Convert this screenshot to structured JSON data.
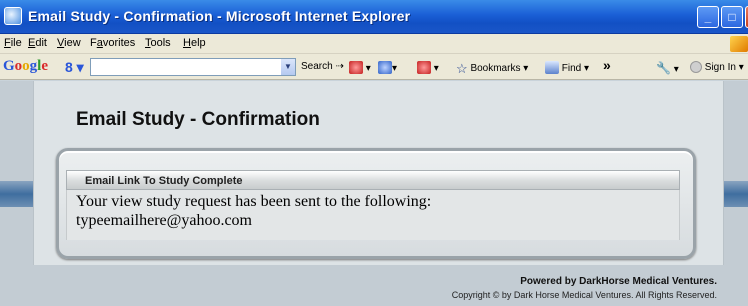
{
  "window": {
    "title": "Email Study - Confirmation - Microsoft Internet Explorer",
    "minimize": "_",
    "maximize": "□",
    "close": "×"
  },
  "menu": {
    "items": [
      {
        "key": "F",
        "rest": "ile"
      },
      {
        "key": "E",
        "rest": "dit"
      },
      {
        "key": "V",
        "rest": "iew"
      },
      {
        "key": "a",
        "pre": "F",
        "rest": "vorites"
      },
      {
        "key": "T",
        "rest": "ools"
      },
      {
        "key": "H",
        "rest": "elp"
      }
    ]
  },
  "toolbar": {
    "google_logo": "Google",
    "search_box_prefix": "8",
    "search_label": "Search",
    "bookmarks_label": "Bookmarks",
    "find_label": "Find",
    "more_label": "»",
    "signin_label": "Sign In",
    "icons": [
      "search-icon",
      "pagerank-icon",
      "popup-blocker-icon",
      "bookmark-star-icon",
      "find-icon",
      "settings-wrench-icon",
      "signin-icon"
    ]
  },
  "page": {
    "title": "Email Study - Confirmation",
    "section_header": "Email Link To Study Complete",
    "message_line1": "Your view study request has been sent to the following:",
    "message_line2": "typeemailhere@yahoo.com",
    "footer_powered": "Powered by DarkHorse Medical Ventures.",
    "footer_copyright": "Copyright © by Dark Horse Medical Ventures. All Rights Reserved."
  },
  "colors": {
    "titlebar": "#1a5fd6",
    "chrome": "#ece9d8",
    "page_bg": "#c3ccd3",
    "panel_bg": "#dde3e6"
  }
}
